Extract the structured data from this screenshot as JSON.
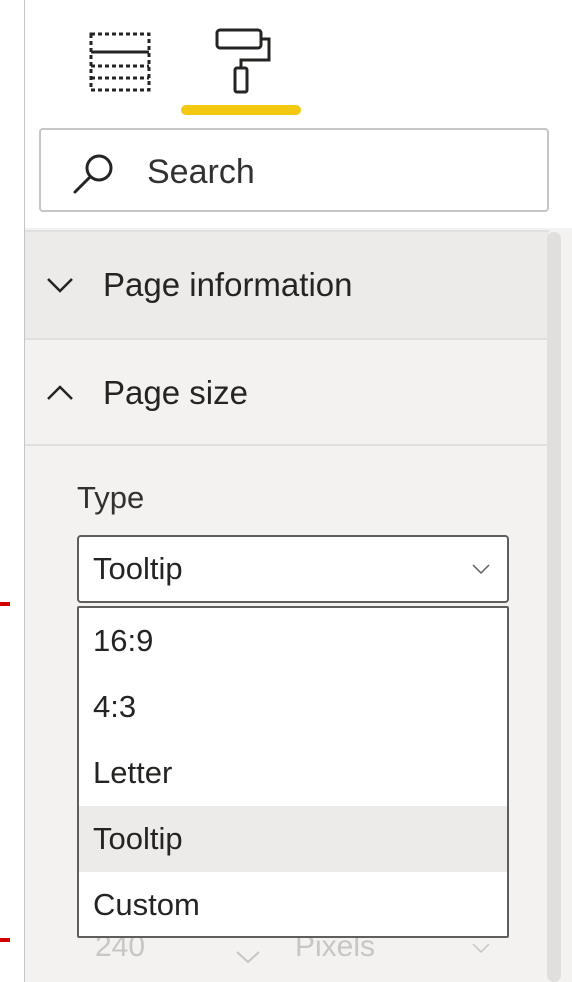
{
  "tabs": [
    {
      "name": "fields-tab",
      "icon": "fields-grid-icon"
    },
    {
      "name": "format-tab",
      "icon": "paint-roller-icon",
      "active": true
    }
  ],
  "accent_color": "#f2c811",
  "search": {
    "placeholder": "Search",
    "icon": "search-icon"
  },
  "sections": {
    "page_information": {
      "label": "Page information",
      "expanded": false,
      "icon": "chevron-down-icon"
    },
    "page_size": {
      "label": "Page size",
      "expanded": true,
      "icon": "chevron-up-icon"
    }
  },
  "page_size": {
    "type_label": "Type",
    "selected": "Tooltip",
    "options": [
      "16:9",
      "4:3",
      "Letter",
      "Tooltip",
      "Custom"
    ],
    "below_dropdown": {
      "value": "240",
      "unit": "Pixels"
    }
  }
}
